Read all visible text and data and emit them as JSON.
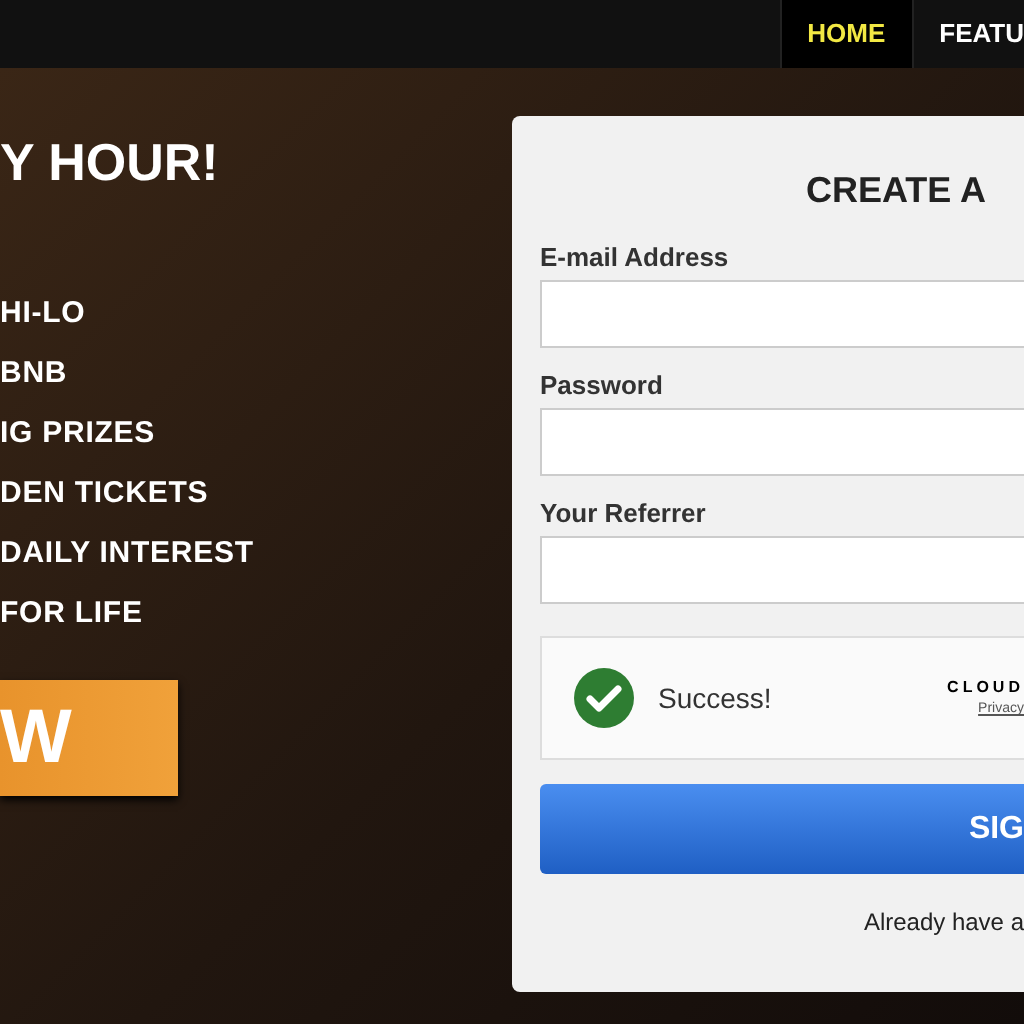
{
  "nav": [
    {
      "label": "HOME",
      "selected": true
    },
    {
      "label": "FEATU",
      "selected": false
    }
  ],
  "hero": {
    "heading": "Y HOUR!",
    "features": [
      "HI-LO",
      "BNB",
      "IG PRIZES",
      "DEN TICKETS",
      "DAILY INTEREST",
      "FOR LIFE"
    ],
    "cta": "W"
  },
  "form": {
    "title": "CREATE A",
    "fields": [
      {
        "label": "E-mail Address"
      },
      {
        "label": "Password"
      },
      {
        "label": "Your Referrer"
      }
    ],
    "captcha": {
      "status": "Success!",
      "verified": true,
      "brand": "CLOUD",
      "link": "Privacy"
    },
    "submit": "SIG",
    "footer": "Already have a"
  }
}
